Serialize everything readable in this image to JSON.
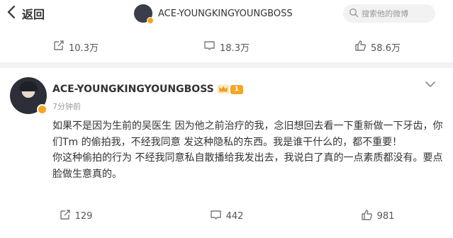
{
  "topbar": {
    "back_label": "返回",
    "username": "ACE-YOUNGKINGYOUNGBOSS",
    "search_placeholder": "搜索他的微博"
  },
  "prev_post_actions": {
    "reposts": "10.3万",
    "comments": "18.3万",
    "likes": "58.6万"
  },
  "post": {
    "author": "ACE-YOUNGKINGYOUNGBOSS",
    "level": "1",
    "time": "7分钟前",
    "text": "如果不是因为生前的吴医生 因为他之前治疗的我，念旧想回去看一下重新做一下牙齿，你们Tm 的偷拍我，不经我同意 发这种隐私的东西。我是谁干什么的，都不重要！\n你这种偷拍的行为 不经我同意私自散播给我发出去，我说白了真的一点素质都没有。要点脸做生意真的。",
    "reposts": "129",
    "comments": "442",
    "likes": "981"
  },
  "icons": {
    "back": "chevron-left-icon",
    "search": "search-icon",
    "repost": "repost-icon",
    "comment": "comment-icon",
    "like": "like-icon",
    "menu": "chevron-down-icon",
    "crown": "crown-icon",
    "verified": "verified-badge-icon"
  },
  "colors": {
    "text": "#333333",
    "secondary": "#999999",
    "badge_orange": "#f7a51b",
    "divider": "#f2f2f2"
  }
}
